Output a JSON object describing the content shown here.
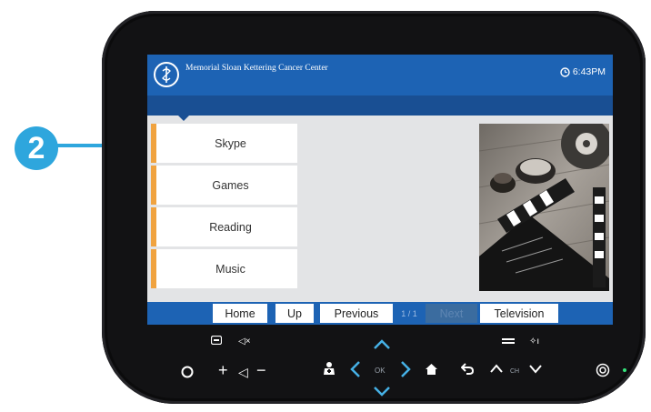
{
  "header": {
    "org_name": "Memorial Sloan Kettering Cancer Center",
    "time": "6:43PM"
  },
  "menu": {
    "items": [
      {
        "label": "Skype"
      },
      {
        "label": "Games"
      },
      {
        "label": "Reading"
      },
      {
        "label": "Music"
      }
    ]
  },
  "navbar": {
    "home": "Home",
    "up": "Up",
    "previous": "Previous",
    "page": "1 / 1",
    "next": "Next",
    "television": "Television"
  },
  "callout": {
    "number": "2"
  },
  "colors": {
    "header_blue": "#1d63b4",
    "menu_accent": "#f0a340",
    "callout_blue": "#2ea6dd",
    "device_body": "#121214"
  },
  "icons": [
    "logo-icon",
    "clock-icon",
    "power-icon",
    "volume-up-icon",
    "volume-down-icon",
    "mute-icon",
    "caption-icon",
    "nurse-call-icon",
    "arrow-up-icon",
    "arrow-down-icon",
    "arrow-left-icon",
    "arrow-right-icon",
    "home-icon",
    "back-icon",
    "channel-up-icon",
    "channel-down-icon",
    "menu-icon",
    "settings-icon"
  ]
}
